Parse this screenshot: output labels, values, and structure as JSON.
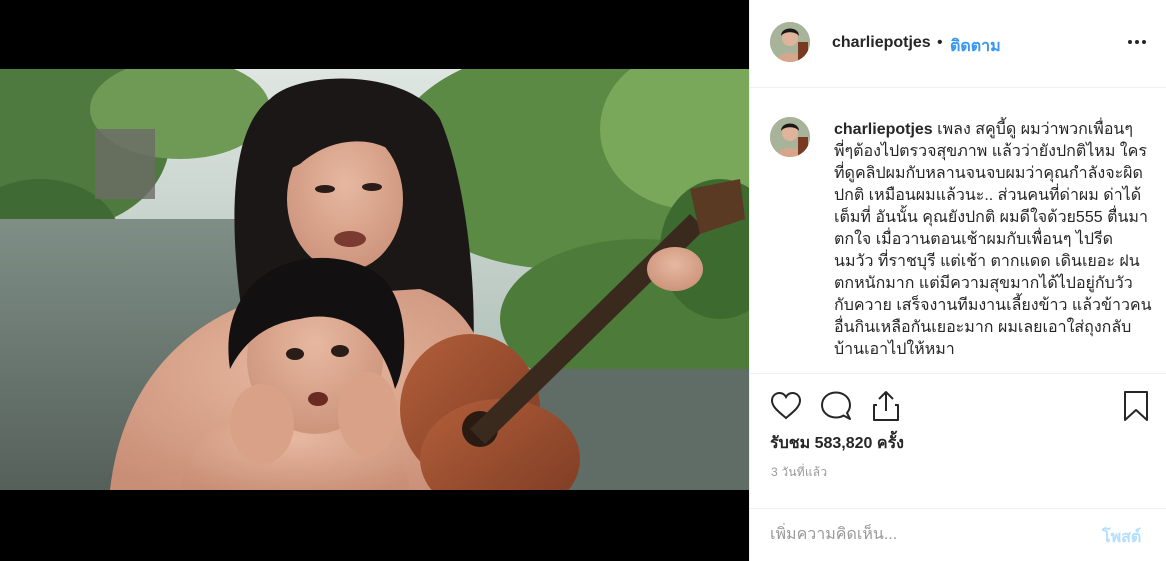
{
  "post": {
    "username": "charliepotjes",
    "separator": "•",
    "follow_label": "ติดตาม",
    "more_icon": "more-options-icon",
    "caption": {
      "username": "charliepotjes",
      "text": " เพลง สคูบี้ดู ผมว่าพวกเพื่อนๆพี่ๆต้องไปตรวจสุขภาพ แล้วว่ายังปกติไหม ใครที่ดูคลิปผมกับหลานจนจบผมว่าคุณกำลังจะผิดปกติ เหมือนผมแล้วนะ.. ส่วนคนที่ด่าผม ด่าได้เต็มที่ อันนั้น คุณยังปกติ ผมดีใจด้วย555 ตื่นมา ตกใจ เมื่อวานตอนเช้าผมกับเพื่อนๆ ไปรีดนมวัว ที่ราชบุรี แต่เช้า ตากแดด เดินเยอะ ฝนตกหนักมาก แต่มีความสุขมากได้ไปอยู่กับวัวกับควาย เสร็จงานทีมงานเลี้ยงข้าว แล้วข้าวคนอื่นกินเหลือกันเยอะมาก ผมเลยเอาใส่ถุงกลับบ้านเอาไปให้หมา"
    },
    "views_label": "รับชม 583,820 ครั้ง",
    "time_label": "3 วันที่แล้ว",
    "comment_placeholder": "เพิ่มความคิดเห็น...",
    "post_label": "โพสต์"
  },
  "icons": {
    "like": "heart-icon",
    "comment": "comment-icon",
    "share": "share-icon",
    "save": "bookmark-icon"
  },
  "colors": {
    "link_blue": "#3897f0",
    "post_disabled": "#b2dffc",
    "muted_text": "#999999",
    "text": "#262626",
    "divider": "#efefef"
  }
}
